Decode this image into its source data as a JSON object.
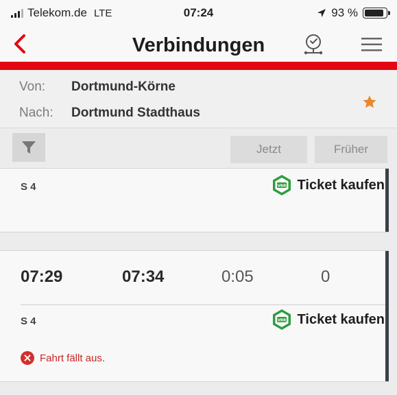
{
  "status_bar": {
    "carrier": "Telekom.de",
    "network": "LTE",
    "time": "07:24",
    "battery": "93 %",
    "battery_level": 0.93,
    "signal_bars_active": 3,
    "icons": [
      "signal-icon",
      "location-arrow-icon",
      "battery-icon"
    ]
  },
  "nav": {
    "title": "Verbindungen",
    "back_icon": "chevron-left-icon",
    "clock_icon": "clock-icon",
    "menu_icon": "hamburger-menu-icon",
    "accent_color": "#e30613"
  },
  "route": {
    "from_label": "Von:",
    "from_value": "Dortmund-Körne",
    "to_label": "Nach:",
    "to_value": "Dortmund Stadthaus",
    "favorite_icon": "star-icon",
    "favorite_color": "#e8892b"
  },
  "toolbar": {
    "filter_icon": "filter-icon",
    "now_label": "Jetzt",
    "earlier_label": "Früher"
  },
  "connections": [
    {
      "line": "S 4",
      "ticket_label": "Ticket kaufen",
      "ticket_icon": "vrr-ticket-icon"
    },
    {
      "departure": "07:29",
      "arrival": "07:34",
      "duration": "0:05",
      "changes": "0",
      "line": "S 4",
      "ticket_label": "Ticket kaufen",
      "ticket_icon": "vrr-ticket-icon",
      "status_icon": "error-circle-icon",
      "status_text": "Fahrt fällt aus.",
      "status_color": "#c62828"
    }
  ]
}
